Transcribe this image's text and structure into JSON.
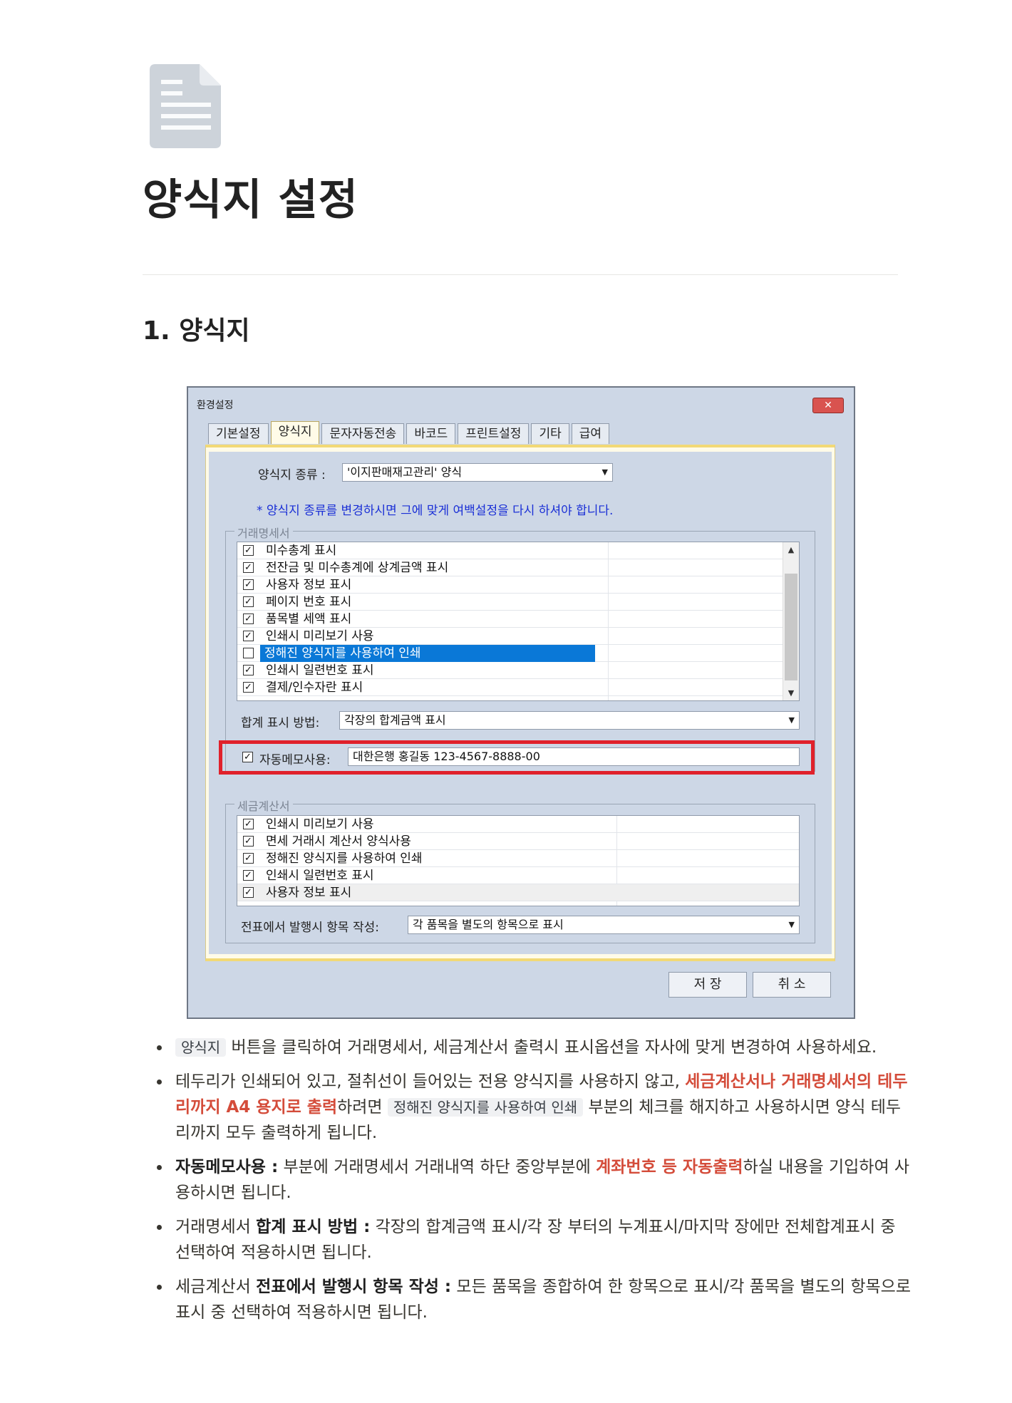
{
  "page": {
    "title": "양식지 설정",
    "section_heading": "1. 양식지"
  },
  "dialog": {
    "title": "환경설정",
    "close": "✕",
    "tabs": [
      "기본설정",
      "양식지",
      "문자자동전송",
      "바코드",
      "프린트설정",
      "기타",
      "급여"
    ],
    "form_type_label": "양식지 종류 :",
    "form_type_value": "'이지판매재고관리' 양식",
    "notice": "* 양식지 종류를 변경하시면 그에 맞게 여백설정을 다시 하셔야 합니다.",
    "statement_group": {
      "legend": "거래명세서",
      "items": [
        {
          "label": "미수총계 표시",
          "checked": true
        },
        {
          "label": "전잔금 및 미수총계에 상계금액 표시",
          "checked": true
        },
        {
          "label": "사용자 정보 표시",
          "checked": true
        },
        {
          "label": "페이지 번호 표시",
          "checked": true
        },
        {
          "label": "품목별 세액 표시",
          "checked": true
        },
        {
          "label": "인쇄시 미리보기 사용",
          "checked": true
        },
        {
          "label": "정해진 양식지를 사용하여 인쇄",
          "checked": false,
          "selected": true
        },
        {
          "label": "인쇄시 일련번호 표시",
          "checked": true
        },
        {
          "label": "결제/인수자란 표시",
          "checked": true
        }
      ],
      "total_label": "합계 표시 방법:",
      "total_value": "각장의 합계금액 표시",
      "memo_label": "자동메모사용:",
      "memo_value": "대한은행 홍길동 123-4567-8888-00",
      "memo_checked": true
    },
    "tax_group": {
      "legend": "세금계산서",
      "items": [
        {
          "label": "인쇄시 미리보기 사용",
          "checked": true
        },
        {
          "label": "면세 거래시 계산서 양식사용",
          "checked": true
        },
        {
          "label": "정해진 양식지를 사용하여 인쇄",
          "checked": true
        },
        {
          "label": "인쇄시 일련번호 표시",
          "checked": true
        },
        {
          "label": "사용자 정보 표시",
          "checked": true
        }
      ],
      "item_label": "전표에서 발행시 항목 작성:",
      "item_value": "각 품목을 별도의 항목으로 표시"
    },
    "save_button": "저 장",
    "cancel_button": "취 소"
  },
  "bullets": {
    "b1": {
      "code": "양식지",
      "text": " 버튼을 클릭하여 거래명세서, 세금계산서 출력시 표시옵션을 자사에 맞게 변경하여 사용하세요."
    },
    "b2": {
      "pre": "테두리가 인쇄되어 있고, 절취선이 들어있는 전용 양식지를 사용하지 않고, ",
      "red": "세금계산서나 거래명세서의 테두리까지 A4 용지로 출력",
      "mid": "하려면 ",
      "code": "정해진 양식지를 사용하여 인쇄",
      "post": " 부분의 체크를 해지하고 사용하시면 양식 테두리까지 모두 출력하게 됩니다."
    },
    "b3": {
      "bold": "자동메모사용 :",
      "pre": " 부분에 거래명세서 거래내역 하단 중앙부분에 ",
      "red": "계좌번호 등 자동출력",
      "post": "하실 내용을 기입하여 사용하시면 됩니다."
    },
    "b4": {
      "pre": "거래명세서 ",
      "bold": "합계 표시 방법 :",
      "post": " 각장의 합계금액 표시/각 장 부터의 누계표시/마지막 장에만 전체합계표시 중 선택하여 적용하시면 됩니다."
    },
    "b5": {
      "pre": "세금계산서 ",
      "bold": "전표에서 발행시 항목 작성 :",
      "post": " 모든 품목을 종합하여 한 항목으로 표시/각 품목을 별도의 항목으로 표시 중 선택하여 적용하시면 됩니다."
    }
  }
}
